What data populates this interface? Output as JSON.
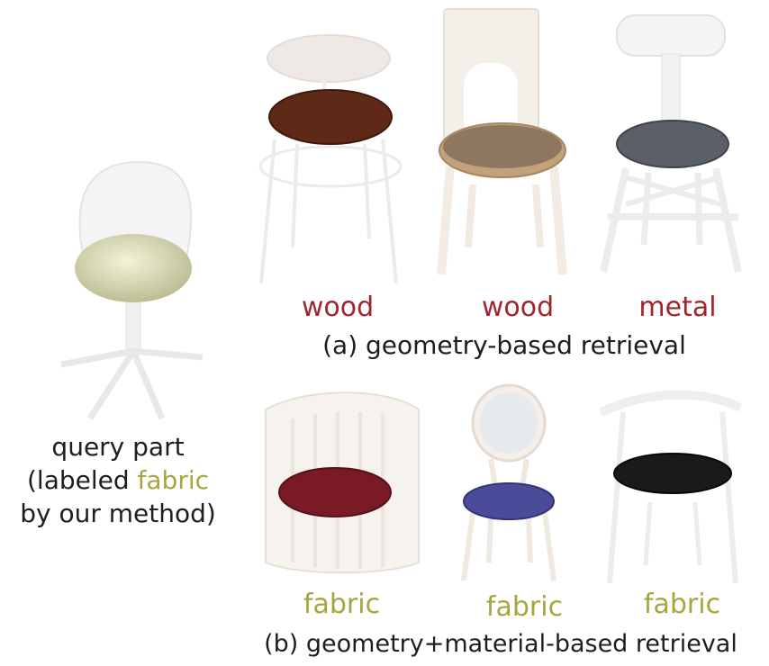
{
  "query": {
    "line1": "query part",
    "line2_prefix": "(labeled ",
    "line2_highlight": "fabric",
    "line3": "by our method)",
    "material": "fabric",
    "seat_color": "#d9dab4"
  },
  "geometry_retrieval": {
    "caption": "(a) geometry-based retrieval",
    "results": [
      {
        "label": "wood",
        "seat_color": "#5e2a17"
      },
      {
        "label": "wood",
        "seat_color": "#c2a27a"
      },
      {
        "label": "metal",
        "seat_color": "#5a5f68"
      }
    ]
  },
  "geometry_material_retrieval": {
    "caption": "(b) geometry+material-based retrieval",
    "results": [
      {
        "label": "fabric",
        "seat_color": "#7a1a25"
      },
      {
        "label": "fabric",
        "seat_color": "#4a4c9a"
      },
      {
        "label": "fabric",
        "seat_color": "#1a1a1a"
      }
    ]
  },
  "colors": {
    "label_mismatch": "#a0252c",
    "label_match": "#a6a63e",
    "frame": "#e9e9e9"
  }
}
